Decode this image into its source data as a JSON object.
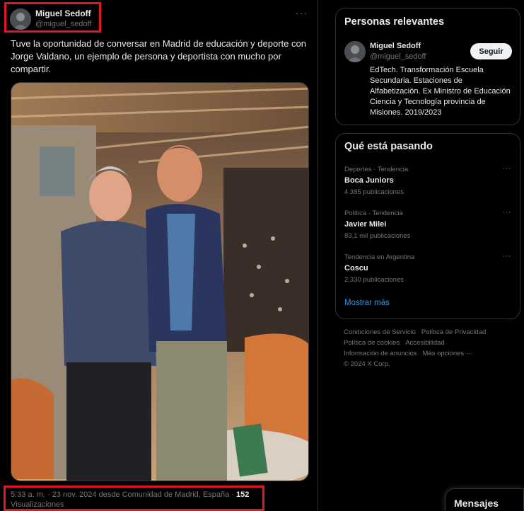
{
  "post": {
    "author_name": "Miguel Sedoff",
    "author_handle": "@miguel_sedoff",
    "more_label": "···",
    "text": "Tuve la oportunidad de conversar en Madrid de educación y deporte con Jorge Valdano, un ejemplo de persona y deportista con mucho por compartir.",
    "meta_prefix": "5:33 a. m. · 23 nov. 2024 desde Comunidad de Madrid, España · ",
    "views_count": "152",
    "views_label": " Visualizaciones"
  },
  "relevant": {
    "title": "Personas relevantes",
    "name": "Miguel Sedoff",
    "handle": "@miguel_sedoff",
    "follow_label": "Seguir",
    "bio": "EdTech. Transformación Escuela Secundaria. Estaciones de Alfabetización. Ex Ministro de Educación Ciencia y Tecnología provincia de Misiones. 2019/2023"
  },
  "trends": {
    "title": "Qué está pasando",
    "more_label": "···",
    "items": [
      {
        "context": "Deportes · Tendencia",
        "name": "Boca Juniors",
        "count": "4.385 publicaciones"
      },
      {
        "context": "Política · Tendencia",
        "name": "Javier Milei",
        "count": "83,1 mil publicaciones"
      },
      {
        "context": "Tendencia en Argentina",
        "name": "Coscu",
        "count": "2.330 publicaciones"
      }
    ],
    "show_more": "Mostrar más"
  },
  "footer": {
    "terms": "Condiciones de Servicio",
    "privacy": "Política de Privacidad",
    "cookies": "Política de cookies",
    "accessibility": "Accesibilidad",
    "ads": "Información de anuncios",
    "more_options": "Más opciones ···",
    "copyright": "© 2024 X Corp."
  },
  "messages": {
    "label": "Mensajes"
  },
  "colors": {
    "background": "#000000",
    "accent": "#1d9bf0",
    "highlight_box": "#e0171f",
    "secondary_text": "#71767b"
  }
}
